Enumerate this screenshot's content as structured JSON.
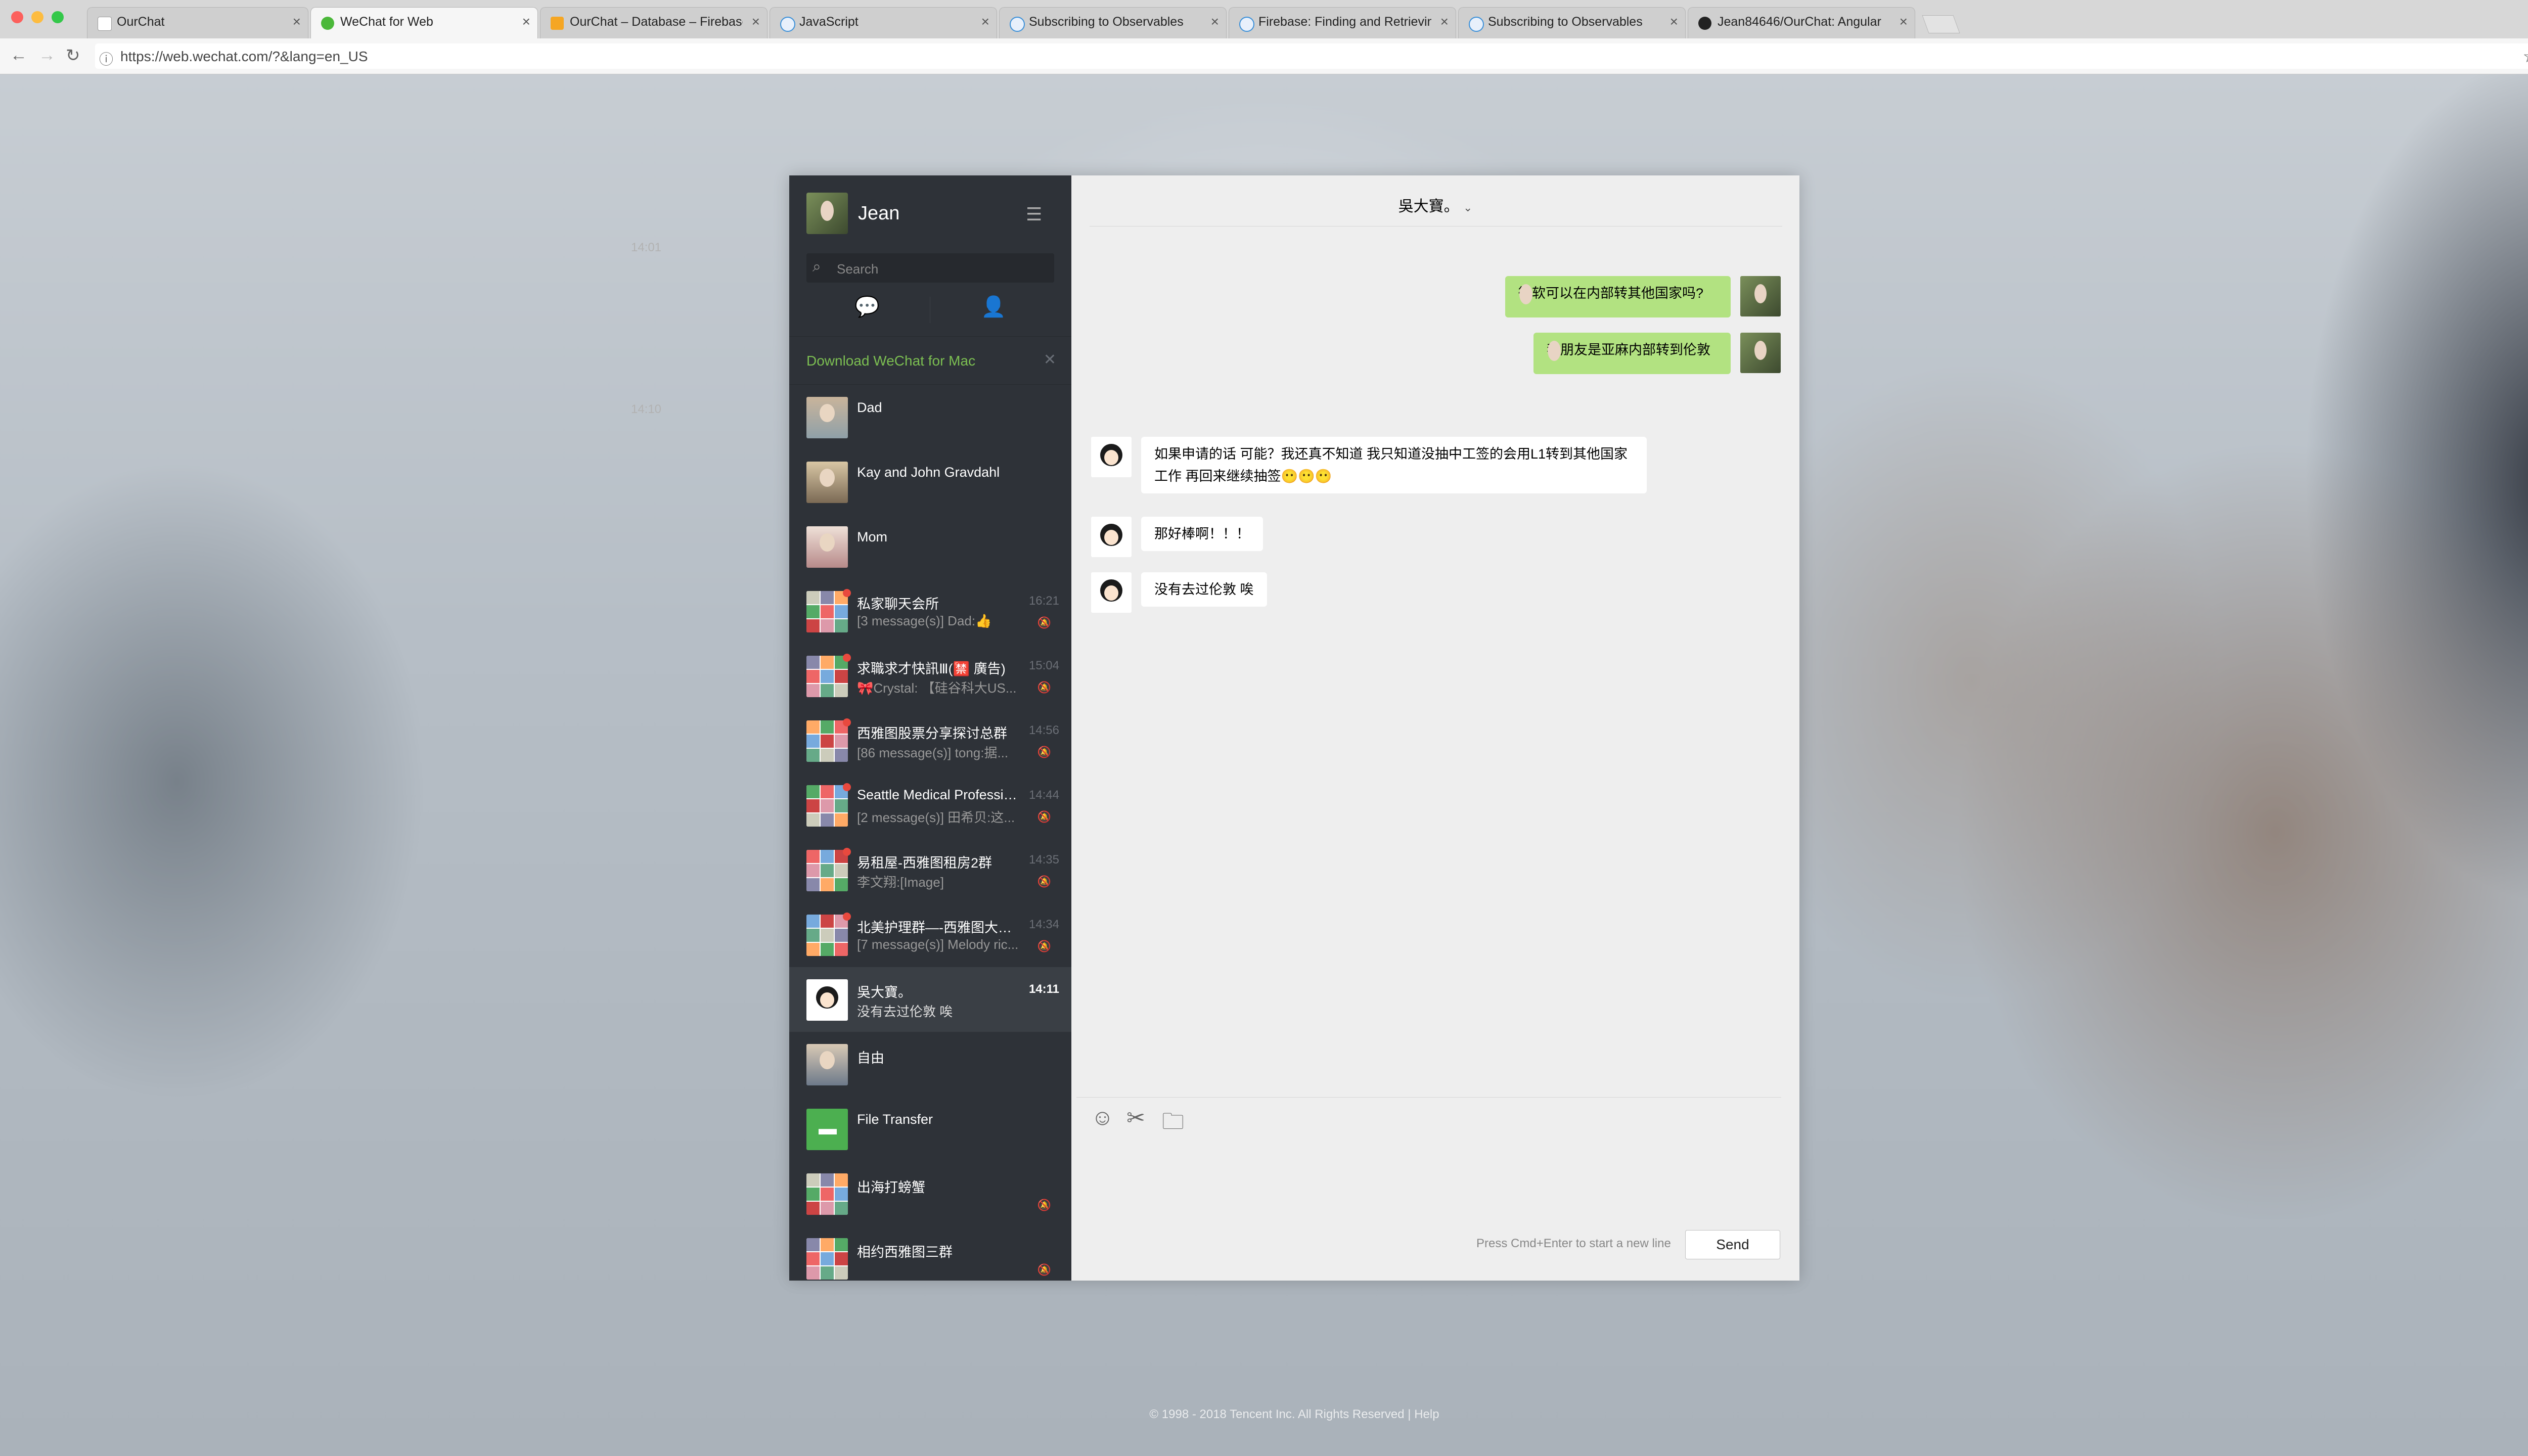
{
  "browser": {
    "tabs": [
      {
        "label": "OurChat",
        "icon": "doc-icon",
        "color": "#ffffff"
      },
      {
        "label": "WeChat for Web",
        "icon": "wechat-icon",
        "color": "#4bb83a"
      },
      {
        "label": "OurChat – Database – Firebase",
        "icon": "firebase-icon",
        "color": "#f5a623"
      },
      {
        "label": "JavaScript",
        "icon": "e-icon",
        "color": "#3a8fd8"
      },
      {
        "label": "Subscribing to Observables",
        "icon": "e-icon",
        "color": "#3a8fd8"
      },
      {
        "label": "Firebase: Finding and Retrieving",
        "icon": "e-icon",
        "color": "#3a8fd8"
      },
      {
        "label": "Subscribing to Observables",
        "icon": "e-icon",
        "color": "#3a8fd8"
      },
      {
        "label": "Jean84646/OurChat: Angular",
        "icon": "github-icon",
        "color": "#222222"
      }
    ],
    "url": "https://web.wechat.com/?&lang=en_US"
  },
  "sidebar": {
    "user_name": "Jean",
    "search_placeholder": "Search",
    "download_banner": "Download WeChat for Mac",
    "conversations": [
      {
        "name": "Dad",
        "message": "",
        "time": "",
        "muted": false,
        "unread": false,
        "selected": false,
        "avatar": "dad"
      },
      {
        "name": "Kay and John Gravdahl",
        "message": "",
        "time": "",
        "muted": false,
        "unread": false,
        "selected": false,
        "avatar": "couple"
      },
      {
        "name": "Mom",
        "message": "",
        "time": "",
        "muted": false,
        "unread": false,
        "selected": false,
        "avatar": "mom"
      },
      {
        "name": "私家聊天会所",
        "message": "[3 message(s)] Dad:👍",
        "time": "16:21",
        "muted": true,
        "unread": true,
        "selected": false,
        "avatar": "group"
      },
      {
        "name": "求職求才快訊Ⅲ(🈲 廣告)",
        "message": "🎀Crystal: 【硅谷科大US...",
        "time": "15:04",
        "muted": true,
        "unread": true,
        "selected": false,
        "avatar": "group"
      },
      {
        "name": "西雅图股票分享探讨总群",
        "message": "[86 message(s)] tong:据...",
        "time": "14:56",
        "muted": true,
        "unread": true,
        "selected": false,
        "avatar": "group"
      },
      {
        "name": "Seattle Medical Professio...",
        "message": "[2 message(s)] 田希贝:这...",
        "time": "14:44",
        "muted": true,
        "unread": true,
        "selected": false,
        "avatar": "group"
      },
      {
        "name": "易租屋-西雅图租房2群",
        "message": "李文翔:[Image]",
        "time": "14:35",
        "muted": true,
        "unread": true,
        "selected": false,
        "avatar": "group"
      },
      {
        "name": "北美护理群—-西雅图大本营",
        "message": "[7 message(s)] Melody ric...",
        "time": "14:34",
        "muted": true,
        "unread": true,
        "selected": false,
        "avatar": "group"
      },
      {
        "name": "吳大寶。",
        "message": "没有去过伦敦 唉",
        "time": "14:11",
        "muted": false,
        "unread": false,
        "selected": true,
        "avatar": "girl"
      },
      {
        "name": "自由",
        "message": "",
        "time": "",
        "muted": false,
        "unread": false,
        "selected": false,
        "avatar": "man"
      },
      {
        "name": "File Transfer",
        "message": "",
        "time": "",
        "muted": false,
        "unread": false,
        "selected": false,
        "avatar": "file"
      },
      {
        "name": "出海打螃蟹",
        "message": "",
        "time": "",
        "muted": true,
        "unread": false,
        "selected": false,
        "avatar": "group"
      },
      {
        "name": "相约西雅图三群",
        "message": "",
        "time": "",
        "muted": true,
        "unread": false,
        "selected": false,
        "avatar": "group"
      }
    ]
  },
  "chat": {
    "title": "吳大寶。",
    "timestamps": [
      "14:01",
      "14:10"
    ],
    "messages": [
      {
        "from": "me",
        "text": "微软可以在内部转其他国家吗?"
      },
      {
        "from": "me",
        "text": "我朋友是亚麻内部转到伦敦"
      },
      {
        "from": "them",
        "text": "如果申请的话 可能？我还真不知道 我只知道没抽中工签的会用L1转到其他国家工作 再回来继续抽签😶😶😶"
      },
      {
        "from": "them",
        "text": "那好棒啊！！！"
      },
      {
        "from": "them",
        "text": "没有去过伦敦 唉"
      }
    ],
    "input_hint": "Press Cmd+Enter to start a new line",
    "send_label": "Send"
  },
  "footer": "© 1998 - 2018 Tencent Inc. All Rights Reserved   |   Help",
  "colors": {
    "sidebar_bg": "#2e3238",
    "accent_green": "#7cbf52",
    "my_bubble": "#b2e281",
    "unread_dot": "#e8493e"
  }
}
